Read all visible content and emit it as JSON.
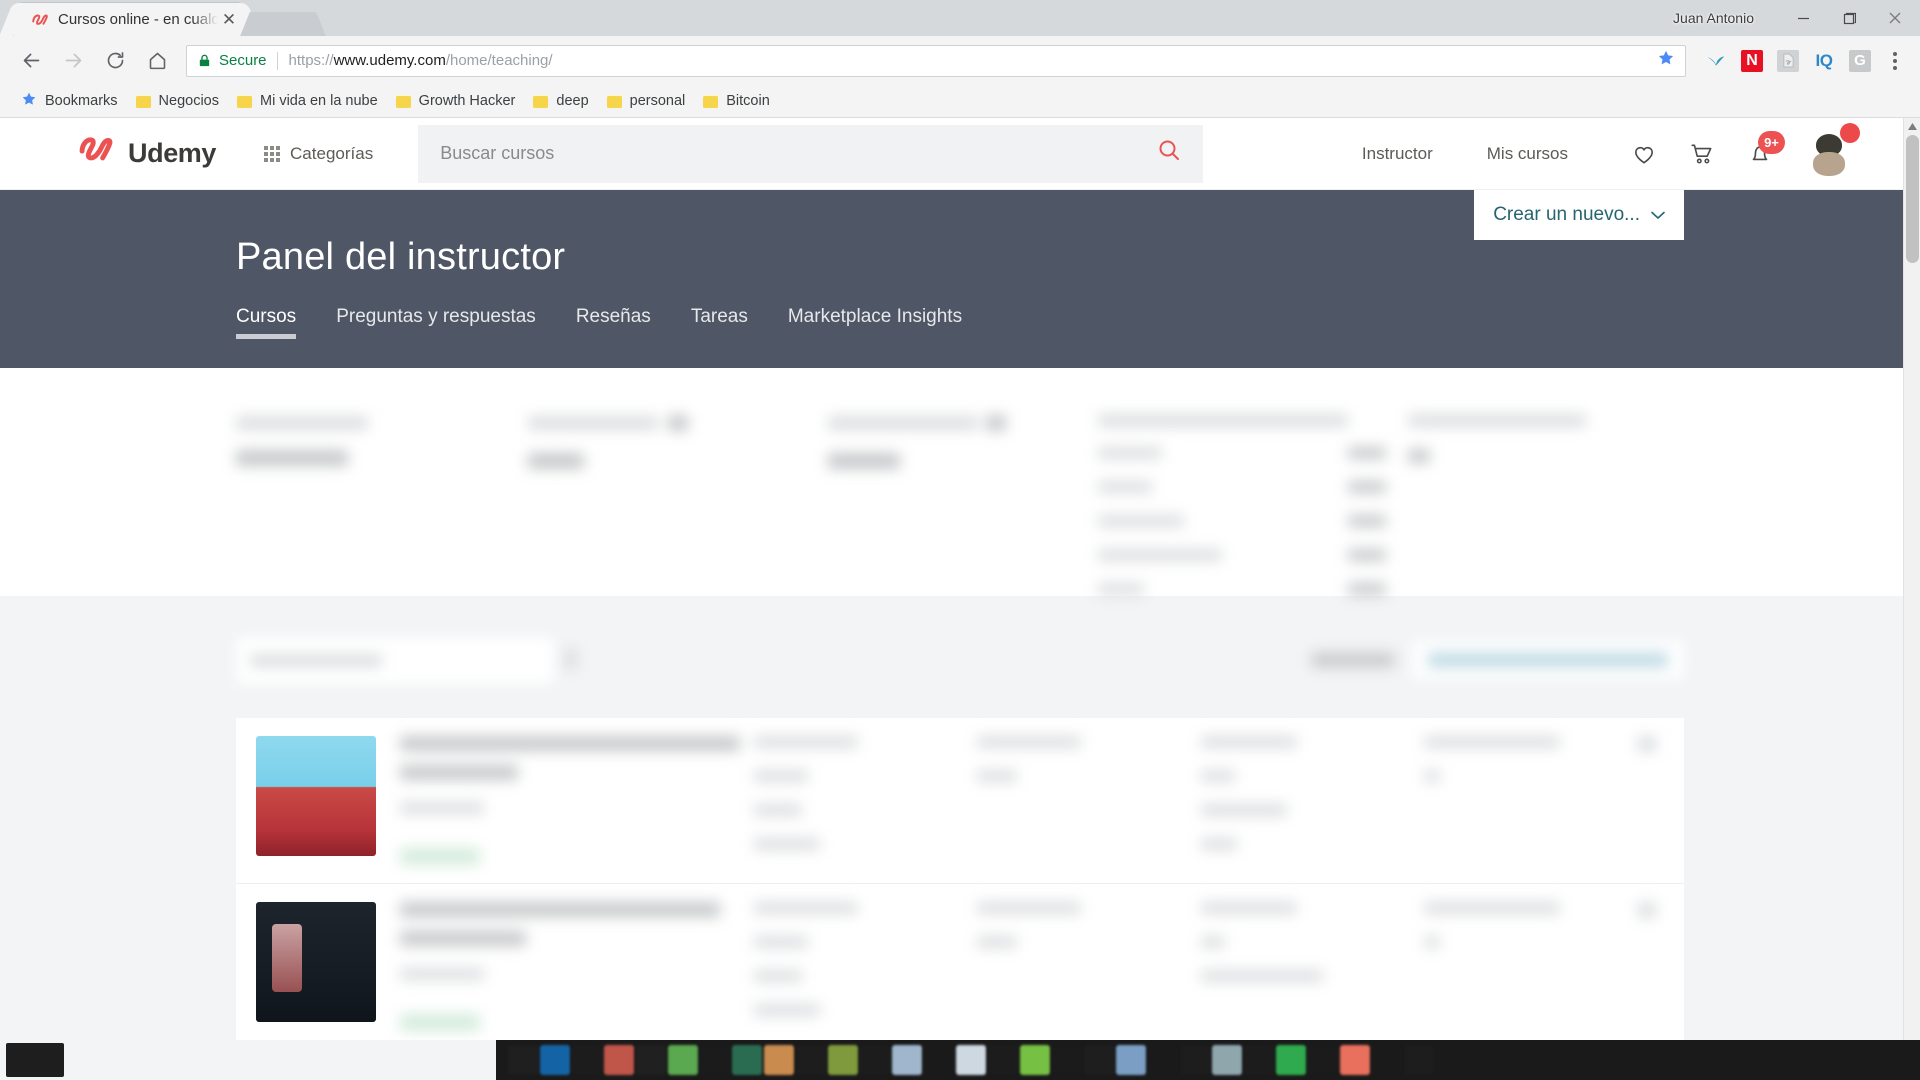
{
  "window": {
    "user_label": "Juan Antonio",
    "minimize_label": "—",
    "maximize_label": "❐",
    "close_label": "✕"
  },
  "browser": {
    "tab": {
      "title": "Cursos online - en cualqu",
      "favicon_name": "udemy-favicon",
      "close_label": "✕"
    },
    "omnibox": {
      "secure_label": "Secure",
      "url_scheme": "https://",
      "url_host": "www.udemy.com",
      "url_path": "/home/teaching/",
      "url_full": "https://www.udemy.com/home/teaching/"
    },
    "nav": {
      "back_label": "←",
      "forward_label": "→",
      "reload_label": "⟳",
      "home_label": "⌂"
    },
    "extensions": [
      {
        "name": "bookmark-star-icon",
        "label": "★",
        "color": "#4c8bf5"
      },
      {
        "name": "swoosh-extension-icon",
        "label": "",
        "color": "#2f9cc4"
      },
      {
        "name": "notion-extension-icon",
        "label": "N",
        "color": "#e81123"
      },
      {
        "name": "pdf-extension-icon",
        "label": "",
        "color": "#d0d2d4"
      },
      {
        "name": "iq-extension-icon",
        "label": "IQ",
        "color": "#2c88c9"
      },
      {
        "name": "grammarly-extension-icon",
        "label": "G",
        "color": "#c7c9cb"
      }
    ],
    "bookmarks": [
      {
        "label": "Bookmarks",
        "icon": "star-icon"
      },
      {
        "label": "Negocios",
        "icon": "folder-icon"
      },
      {
        "label": "Mi vida en la nube",
        "icon": "folder-icon"
      },
      {
        "label": "Growth Hacker",
        "icon": "folder-icon"
      },
      {
        "label": "deep",
        "icon": "folder-icon"
      },
      {
        "label": "personal",
        "icon": "folder-icon"
      },
      {
        "label": "Bitcoin",
        "icon": "folder-icon"
      }
    ]
  },
  "page": {
    "header": {
      "logo_text": "Udemy",
      "categories_label": "Categorías",
      "search_placeholder": "Buscar cursos",
      "search_value": "",
      "nav_links": [
        {
          "label": "Instructor"
        },
        {
          "label": "Mis cursos"
        }
      ],
      "wishlist_icon": "heart-icon",
      "cart_icon": "cart-icon",
      "notifications_icon": "bell-icon",
      "notifications_badge": "9+",
      "avatar_icon": "avatar"
    },
    "hero": {
      "title": "Panel del instructor",
      "background_color": "#4f5665",
      "cta_label": "Crear un nuevo...",
      "cta_chevron": "⌄",
      "cta_text_color": "#26656e",
      "tabs": [
        {
          "label": "Cursos",
          "active": true
        },
        {
          "label": "Preguntas y respuestas",
          "active": false
        },
        {
          "label": "Reseñas",
          "active": false
        },
        {
          "label": "Tareas",
          "active": false
        },
        {
          "label": "Marketplace Insights",
          "active": false
        }
      ]
    },
    "stats_strip": {
      "obscured": true,
      "note": "blurred"
    },
    "course_list": {
      "background_color": "#f2f4f5",
      "filters_obscured": true,
      "rows": [
        {
          "thumbnail": "blue-red-portrait",
          "obscured": true,
          "badge_color": "#def0e4"
        },
        {
          "thumbnail": "dark-navy-portrait",
          "obscured": true,
          "badge_color": "#def0e4"
        }
      ]
    },
    "scrollbar": {
      "up_arrow": "▲",
      "down_arrow": "▼"
    }
  },
  "taskbar": {
    "background_color": "#1a1a1b",
    "obscured": true
  }
}
